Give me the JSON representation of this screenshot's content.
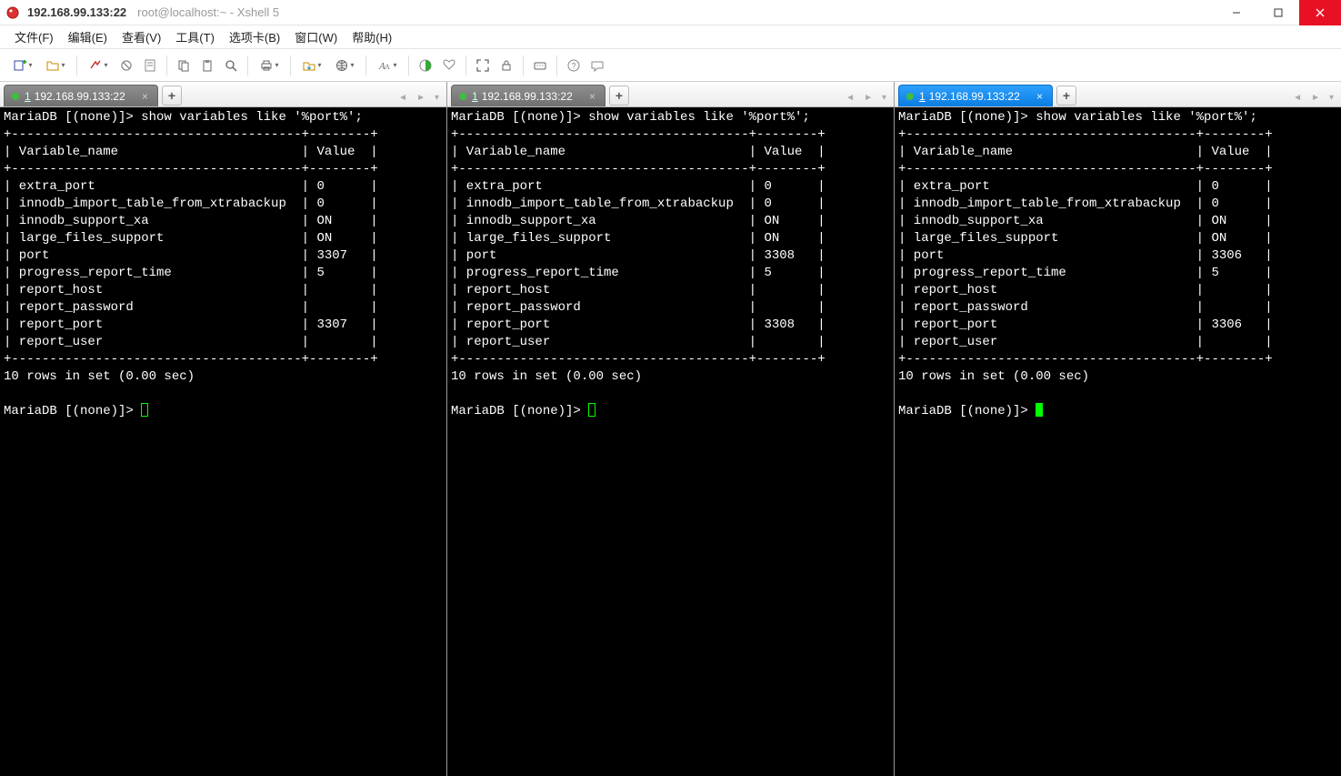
{
  "window": {
    "title_main": "192.168.99.133:22",
    "title_sub": "root@localhost:~ - Xshell 5"
  },
  "menu": {
    "items": [
      "文件(F)",
      "编辑(E)",
      "查看(V)",
      "工具(T)",
      "选项卡(B)",
      "窗口(W)",
      "帮助(H)"
    ]
  },
  "tabs": {
    "add_label": "+",
    "num_prefix": "1",
    "label": "192.168.99.133:22",
    "close_glyph": "×",
    "nav_left": "◄",
    "nav_right": "►",
    "nav_menu": "▾"
  },
  "terminal": {
    "prompt_cmd": "MariaDB [(none)]> show variables like '%port%';",
    "hdr_var": "Variable_name",
    "hdr_val": "Value",
    "summary": "10 rows in set (0.00 sec)",
    "prompt_idle": "MariaDB [(none)]> ",
    "rows_names": [
      "extra_port",
      "innodb_import_table_from_xtrabackup",
      "innodb_support_xa",
      "large_files_support",
      "port",
      "progress_report_time",
      "report_host",
      "report_password",
      "report_port",
      "report_user"
    ]
  },
  "panes": [
    {
      "active": false,
      "values": [
        "0",
        "0",
        "ON",
        "ON",
        "3307",
        "5",
        "",
        "",
        "3307",
        ""
      ]
    },
    {
      "active": false,
      "values": [
        "0",
        "0",
        "ON",
        "ON",
        "3308",
        "5",
        "",
        "",
        "3308",
        ""
      ]
    },
    {
      "active": true,
      "values": [
        "0",
        "0",
        "ON",
        "ON",
        "3306",
        "5",
        "",
        "",
        "3306",
        ""
      ]
    }
  ]
}
